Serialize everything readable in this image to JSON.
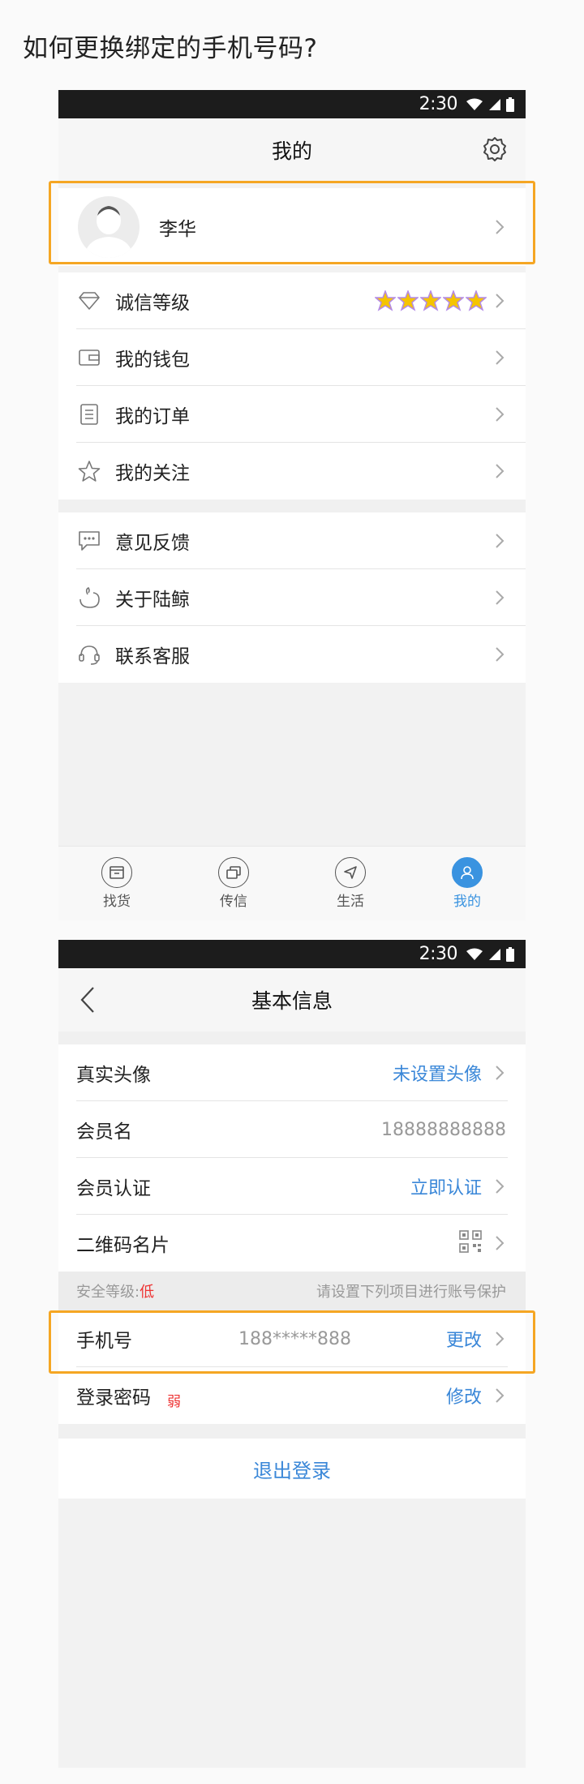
{
  "heading": "如何更换绑定的手机号码?",
  "status": {
    "time": "2:30"
  },
  "colors": {
    "accent": "#3a93e0",
    "highlight": "#f5a623",
    "danger": "#e33333"
  },
  "my_page": {
    "title": "我的",
    "profile": {
      "name": "李华"
    },
    "menu_group_1": [
      {
        "label": "诚信等级",
        "icon": "diamond-icon"
      },
      {
        "label": "我的钱包",
        "icon": "wallet-icon"
      },
      {
        "label": "我的订单",
        "icon": "order-list-icon"
      },
      {
        "label": "我的关注",
        "icon": "star-outline-icon"
      }
    ],
    "menu_group_2": [
      {
        "label": "意见反馈",
        "icon": "feedback-bubble-icon"
      },
      {
        "label": "关于陆鲸",
        "icon": "whale-icon"
      },
      {
        "label": "联系客服",
        "icon": "headset-icon"
      }
    ],
    "credit_stars": 5,
    "tabs": [
      {
        "label": "找货",
        "icon": "cargo-box-icon"
      },
      {
        "label": "传信",
        "icon": "message-icon"
      },
      {
        "label": "生活",
        "icon": "compass-arrow-icon"
      },
      {
        "label": "我的",
        "icon": "person-icon",
        "active": true
      }
    ]
  },
  "info_page": {
    "title": "基本信息",
    "rows": [
      {
        "label": "真实头像",
        "value": "未设置头像"
      },
      {
        "label": "会员名",
        "value": "18888888888"
      },
      {
        "label": "会员认证",
        "value": "立即认证"
      },
      {
        "label": "二维码名片",
        "icon": "qr-code-icon"
      }
    ],
    "security": {
      "label": "安全等级:",
      "level": "低",
      "hint": "请设置下列项目进行账号保护"
    },
    "phone": {
      "label": "手机号",
      "number": "188*****888",
      "action": "更改"
    },
    "password": {
      "label": "登录密码",
      "strength": "弱",
      "action": "修改"
    },
    "logout": "退出登录"
  }
}
